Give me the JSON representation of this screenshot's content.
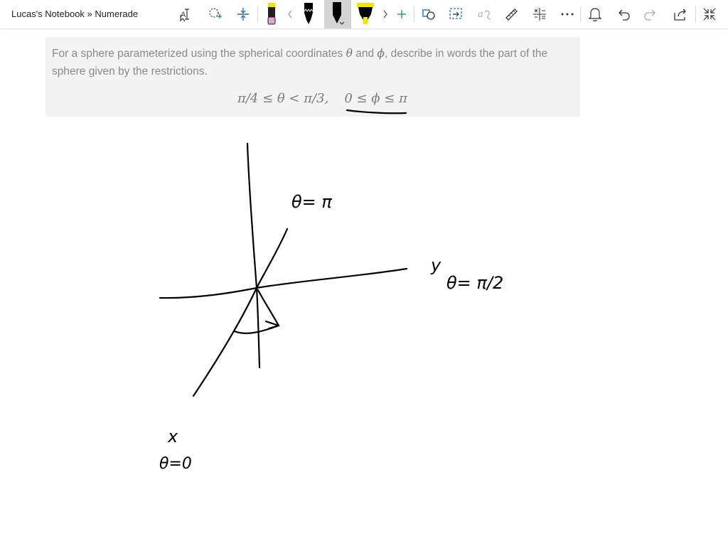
{
  "app": {
    "title": "Lucas's Notebook » Numerade"
  },
  "toolbar": {
    "tools": [
      {
        "name": "text-select-icon"
      },
      {
        "name": "lasso-select-icon"
      },
      {
        "name": "add-space-icon"
      },
      {
        "name": "eraser-pen-icon",
        "color": "#e6a0d8"
      },
      {
        "name": "chevron-left-icon"
      },
      {
        "name": "ballpoint-pen-icon",
        "color": "#000000"
      },
      {
        "name": "selected-pen-icon",
        "color": "#000000"
      },
      {
        "name": "highlighter-icon",
        "color": "#f5e400"
      },
      {
        "name": "chevron-right-icon"
      },
      {
        "name": "add-pen-icon",
        "color": "#2aa84a"
      },
      {
        "name": "ink-to-shape-icon"
      },
      {
        "name": "lasso-convert-icon"
      },
      {
        "name": "ink-to-math-icon"
      },
      {
        "name": "ruler-icon"
      },
      {
        "name": "math-icon"
      },
      {
        "name": "more-icon"
      },
      {
        "name": "notifications-bell-icon"
      },
      {
        "name": "undo-icon"
      },
      {
        "name": "redo-icon"
      },
      {
        "name": "share-icon"
      },
      {
        "name": "fullscreen-icon"
      }
    ]
  },
  "problem": {
    "text_part1": "For a sphere parameterized using the spherical coordinates ",
    "theta": "θ",
    "text_and": " and ",
    "phi": "ϕ",
    "text_part2": ", describe in words the part of the sphere given by the restrictions.",
    "formula_left": "π/4 ≤ θ < π/3,",
    "formula_right": "0 ≤ ϕ ≤ π"
  },
  "handwriting": {
    "theta_pi": "θ= π",
    "y_label": "y",
    "theta_pi_half": "θ= π/2",
    "x_label": "x",
    "theta_zero": "θ=0"
  },
  "colors": {
    "ink": "#000000",
    "problem_bg": "#f3f3f3",
    "problem_text": "#8a8a8a"
  }
}
